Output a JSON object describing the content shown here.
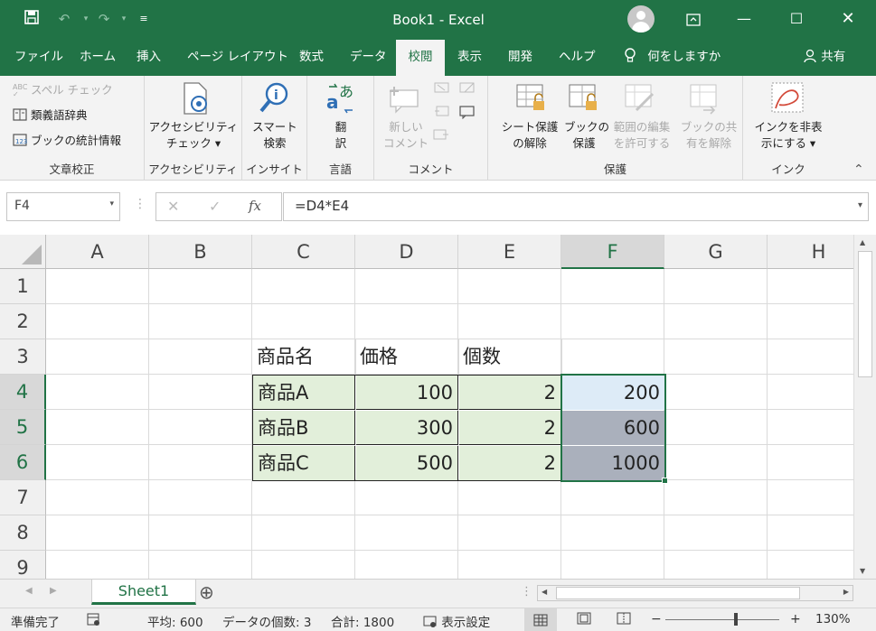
{
  "titlebar": {
    "title": "Book1  -  Excel",
    "save_icon": "save-icon",
    "undo_icon": "undo-icon",
    "redo_icon": "redo-icon",
    "customize_icon": "customize-qat-icon"
  },
  "menu": {
    "items": [
      "ファイル",
      "ホーム",
      "挿入",
      "ページ レイアウト",
      "数式",
      "データ",
      "校閲",
      "表示",
      "開発",
      "ヘルプ"
    ],
    "active": "校閲",
    "tell_me": "何をしますか",
    "share": "共有"
  },
  "ribbon": {
    "proofing": {
      "spell": "スペル チェック",
      "thesaurus": "類義語辞典",
      "stats": "ブックの統計情報",
      "label": "文章校正"
    },
    "accessibility": {
      "btn_line1": "アクセシビリティ",
      "btn_line2": "チェック ▾",
      "label": "アクセシビリティ"
    },
    "insights": {
      "btn_line1": "スマート",
      "btn_line2": "検索",
      "label": "インサイト"
    },
    "language": {
      "btn_line1": "翻",
      "btn_line2": "訳",
      "label": "言語"
    },
    "comments": {
      "btn_line1": "新しい",
      "btn_line2": "コメント",
      "label": "コメント"
    },
    "protect": {
      "unprotect_line1": "シート保護",
      "unprotect_line2": "の解除",
      "book_line1": "ブックの",
      "book_line2": "保護",
      "range_line1": "範囲の編集",
      "range_line2": "を許可する",
      "share_line1": "ブックの共",
      "share_line2": "有を解除",
      "label": "保護"
    },
    "ink": {
      "btn_line1": "インクを非表",
      "btn_line2": "示にする ▾",
      "label": "インク"
    }
  },
  "formula_bar": {
    "name_box": "F4",
    "formula": "=D4*E4",
    "fx": "fx"
  },
  "sheet": {
    "columns": [
      "A",
      "B",
      "C",
      "D",
      "E",
      "F",
      "G",
      "H"
    ],
    "rows": [
      "1",
      "2",
      "3",
      "4",
      "5",
      "6",
      "7",
      "8",
      "9"
    ],
    "headers": {
      "c": "商品名",
      "d": "価格",
      "e": "個数"
    },
    "data": [
      {
        "name": "商品A",
        "price": "100",
        "qty": "2",
        "total": "200"
      },
      {
        "name": "商品B",
        "price": "300",
        "qty": "2",
        "total": "600"
      },
      {
        "name": "商品C",
        "price": "500",
        "qty": "2",
        "total": "1000"
      }
    ]
  },
  "tabs": {
    "sheet1": "Sheet1",
    "add": "⊕"
  },
  "status": {
    "ready": "準備完了",
    "average": "平均: 600",
    "count": "データの個数: 3",
    "sum": "合計: 1800",
    "display_settings": "表示設定",
    "zoom": "130%"
  },
  "colors": {
    "accent": "#217346",
    "selection": "#aab0bc",
    "active_cell": "#ddebf7",
    "table_fill": "#e2efda"
  }
}
